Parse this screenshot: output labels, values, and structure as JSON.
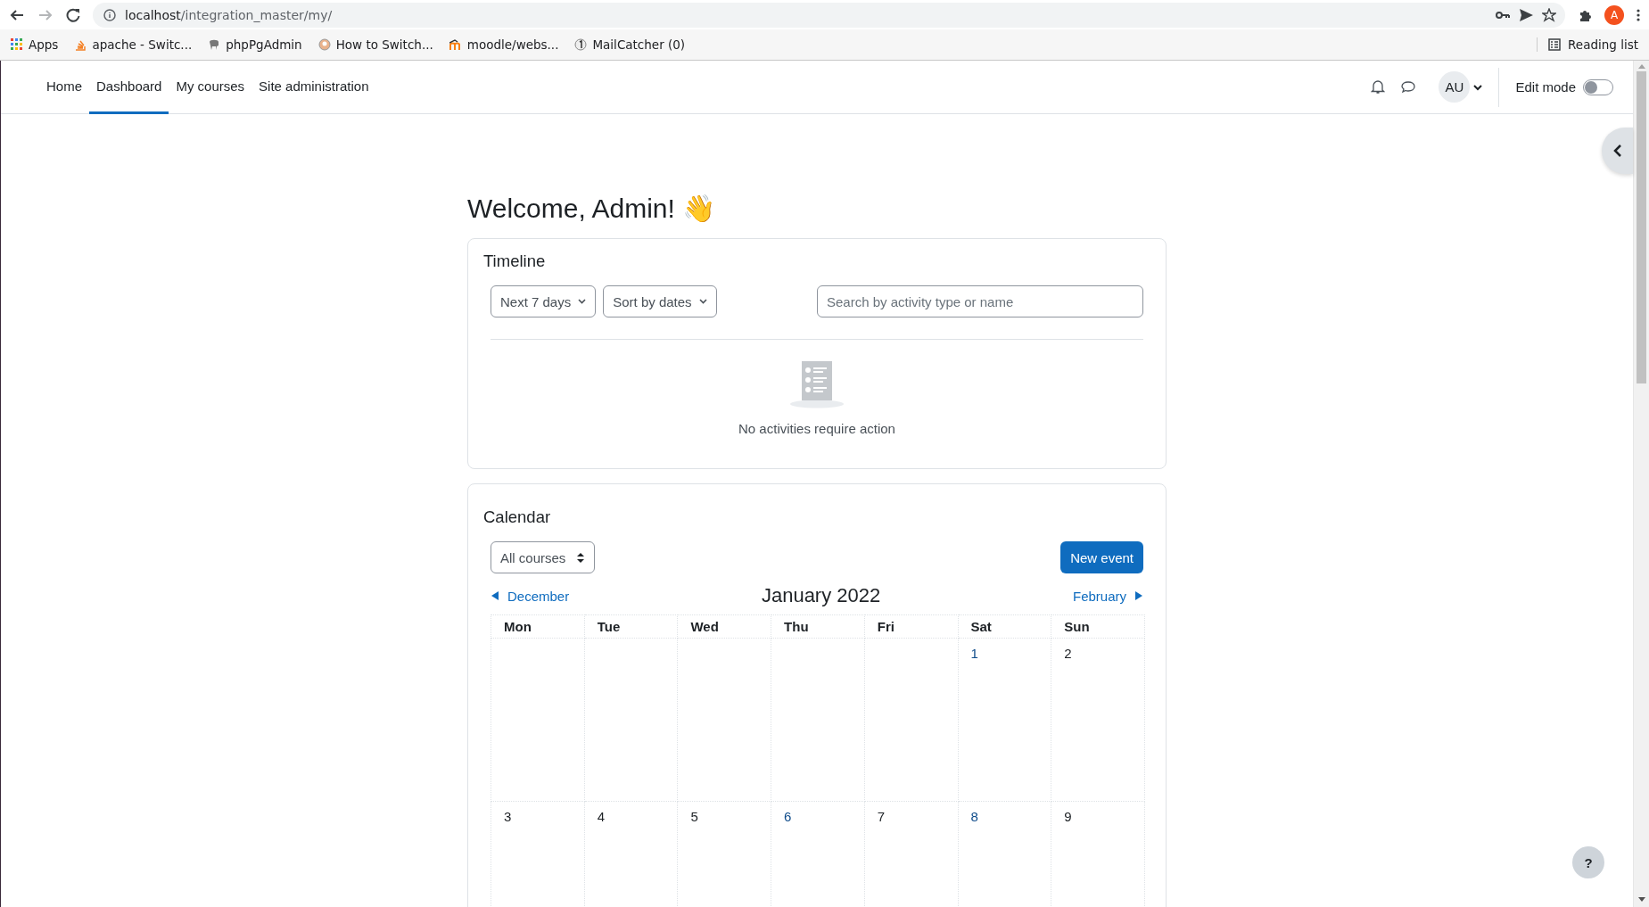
{
  "browser": {
    "url_host": "localhost",
    "url_path": "/integration_master/my/",
    "forward_disabled": true,
    "profile_initial": "A",
    "bookmarks": [
      {
        "label": "Apps",
        "kind": "apps"
      },
      {
        "label": "apache - Switc...",
        "kind": "stack"
      },
      {
        "label": "phpPgAdmin",
        "kind": "elephant"
      },
      {
        "label": "How to Switch...",
        "kind": "face"
      },
      {
        "label": "moodle/webs...",
        "kind": "moodle"
      },
      {
        "label": "MailCatcher (0)",
        "kind": "mail"
      }
    ],
    "reading_list": "Reading list"
  },
  "navbar": {
    "items": [
      {
        "label": "Home",
        "selected": false
      },
      {
        "label": "Dashboard",
        "selected": true
      },
      {
        "label": "My courses",
        "selected": false
      },
      {
        "label": "Site administration",
        "selected": false
      }
    ],
    "avatar": "AU",
    "edit_mode": {
      "label": "Edit mode",
      "on": false
    }
  },
  "welcome": "Welcome, Admin! 👋",
  "timeline": {
    "title": "Timeline",
    "filters": [
      "Next 7 days",
      "Sort by dates"
    ],
    "search": {
      "placeholder": "Search by activity type or name"
    },
    "empty_message": "No activities require action"
  },
  "calendar": {
    "title": "Calendar",
    "course_select": "All courses",
    "new_event": "New event",
    "prev_month": "December",
    "month": "January 2022",
    "next_month": "February",
    "weekdays": [
      "Mon",
      "Tue",
      "Wed",
      "Thu",
      "Fri",
      "Sat",
      "Sun"
    ],
    "weeks": [
      [
        {
          "kind": "blank"
        },
        {
          "kind": "blank"
        },
        {
          "kind": "blank"
        },
        {
          "kind": "blank"
        },
        {
          "kind": "blank"
        },
        {
          "kind": "day",
          "day": "1",
          "linked": true
        },
        {
          "kind": "day",
          "day": "2",
          "linked": false
        }
      ],
      [
        {
          "kind": "day",
          "day": "3",
          "linked": false
        },
        {
          "kind": "day",
          "day": "4",
          "linked": false
        },
        {
          "kind": "day",
          "day": "5",
          "linked": false
        },
        {
          "kind": "day",
          "day": "6",
          "linked": true
        },
        {
          "kind": "day",
          "day": "7",
          "linked": false
        },
        {
          "kind": "day",
          "day": "8",
          "linked": true
        },
        {
          "kind": "day",
          "day": "9",
          "linked": false
        }
      ]
    ]
  },
  "help": "?"
}
